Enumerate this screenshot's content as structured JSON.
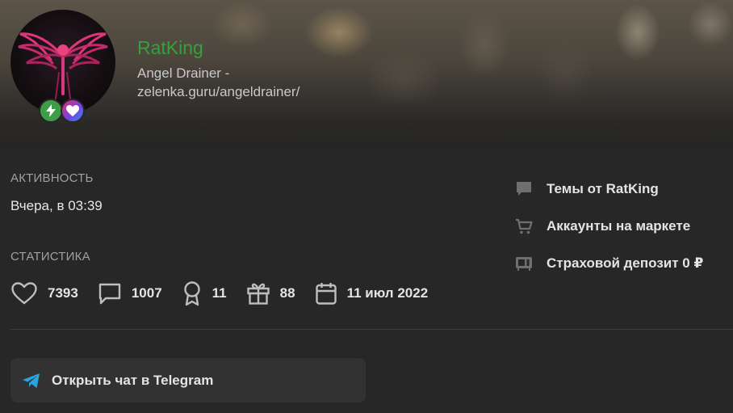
{
  "profile": {
    "username": "RatKing",
    "status": "Angel Drainer - zelenka.guru/angeldrainer/",
    "badges": [
      "bolt-icon",
      "heart-icon"
    ]
  },
  "activity": {
    "label": "АКТИВНОСТЬ",
    "value": "Вчера, в 03:39"
  },
  "statistics": {
    "label": "СТАТИСТИКА",
    "items": [
      {
        "icon": "heart-outline-icon",
        "value": "7393"
      },
      {
        "icon": "message-icon",
        "value": "1007"
      },
      {
        "icon": "award-icon",
        "value": "11"
      },
      {
        "icon": "gift-icon",
        "value": "88"
      },
      {
        "icon": "calendar-icon",
        "value": "11 июл 2022"
      }
    ]
  },
  "links": [
    {
      "icon": "chat-bubble-icon",
      "label": "Темы от RatKing"
    },
    {
      "icon": "cart-icon",
      "label": "Аккаунты на маркете"
    },
    {
      "icon": "deposit-icon",
      "label": "Страховой депозит 0 ₽"
    }
  ],
  "telegram": {
    "icon": "telegram-icon",
    "label": "Открыть чат в Telegram"
  },
  "colors": {
    "username": "#33a237",
    "background": "#272727",
    "button": "#323232",
    "telegram": "#2aa3e3"
  }
}
